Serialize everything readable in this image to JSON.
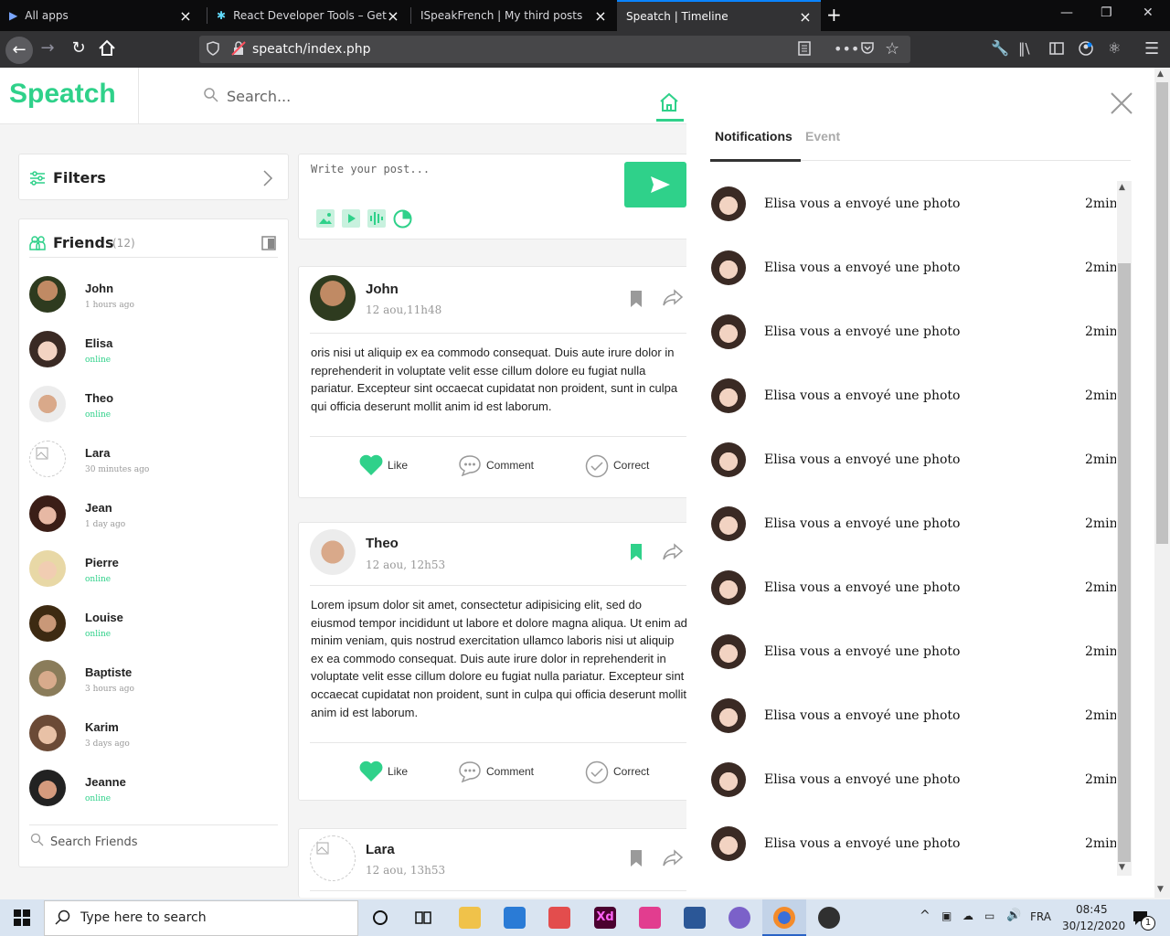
{
  "browser": {
    "tabs": [
      {
        "title": "All apps",
        "active": false
      },
      {
        "title": "React Developer Tools – Get thi",
        "active": false
      },
      {
        "title": "ISpeakFrench | My third posts",
        "active": false
      },
      {
        "title": "Speatch | Timeline",
        "active": true
      }
    ],
    "url": "speatch/index.php"
  },
  "app": {
    "logo": "Speatch",
    "search_placeholder": "Search...",
    "filters_label": "Filters",
    "friends_label": "Friends",
    "friends_count": "(12)",
    "friends": [
      {
        "name": "John",
        "status": "1 hours ago",
        "online": false
      },
      {
        "name": "Elisa",
        "status": "online",
        "online": true
      },
      {
        "name": "Theo",
        "status": "online",
        "online": true
      },
      {
        "name": "Lara",
        "status": "30 minutes ago",
        "online": false
      },
      {
        "name": "Jean",
        "status": "1 day ago",
        "online": false
      },
      {
        "name": "Pierre",
        "status": "online",
        "online": true
      },
      {
        "name": "Louise",
        "status": "online",
        "online": true
      },
      {
        "name": "Baptiste",
        "status": "3 hours ago",
        "online": false
      },
      {
        "name": "Karim",
        "status": "3 days ago",
        "online": false
      },
      {
        "name": "Jeanne",
        "status": "online",
        "online": true
      }
    ],
    "search_friends_placeholder": "Search Friends",
    "write_placeholder": "Write your post...",
    "posts": [
      {
        "author": "John",
        "date": "12 aou,11h48",
        "body": "oris nisi ut aliquip ex ea commodo consequat. Duis aute irure dolor in reprehenderit in voluptate velit esse cillum dolore eu fugiat nulla pariatur. Excepteur sint occaecat cupidatat non proident, sunt in culpa qui officia deserunt mollit anim id est laborum.",
        "bookmarked": false
      },
      {
        "author": "Theo",
        "date": "12 aou, 12h53",
        "body": "Lorem ipsum dolor sit amet, consectetur adipisicing elit, sed do eiusmod tempor incididunt ut labore et dolore magna aliqua. Ut enim ad minim veniam, quis nostrud exercitation ullamco laboris nisi ut aliquip ex ea commodo consequat. Duis aute irure dolor in reprehenderit in voluptate velit esse cillum dolore eu fugiat nulla pariatur. Excepteur sint occaecat cupidatat non proident, sunt in culpa qui officia deserunt mollit anim id est laborum.",
        "bookmarked": true
      },
      {
        "author": "Lara",
        "date": "12 aou, 13h53",
        "body": "",
        "bookmarked": false
      }
    ],
    "actions": {
      "like": "Like",
      "comment": "Comment",
      "correct": "Correct"
    }
  },
  "notifications": {
    "tab_notifications": "Notifications",
    "tab_event": "Event",
    "items": [
      {
        "text": "Elisa vous a envoyé une photo",
        "time": "2min"
      },
      {
        "text": "Elisa vous a envoyé une photo",
        "time": "2min"
      },
      {
        "text": "Elisa vous a envoyé une photo",
        "time": "2min"
      },
      {
        "text": "Elisa vous a envoyé une photo",
        "time": "2min"
      },
      {
        "text": "Elisa vous a envoyé une photo",
        "time": "2min"
      },
      {
        "text": "Elisa vous a envoyé une photo",
        "time": "2min"
      },
      {
        "text": "Elisa vous a envoyé une photo",
        "time": "2min"
      },
      {
        "text": "Elisa vous a envoyé une photo",
        "time": "2min"
      },
      {
        "text": "Elisa vous a envoyé une photo",
        "time": "2min"
      },
      {
        "text": "Elisa vous a envoyé une photo",
        "time": "2min"
      },
      {
        "text": "Elisa vous a envoyé une photo",
        "time": "2min"
      }
    ]
  },
  "taskbar": {
    "search_placeholder": "Type here to search",
    "lang": "FRA",
    "time": "08:45",
    "date": "30/12/2020",
    "notif_count": "1"
  },
  "colors": {
    "accent": "#2fd18a",
    "bookmark_active": "#2fd18a"
  }
}
